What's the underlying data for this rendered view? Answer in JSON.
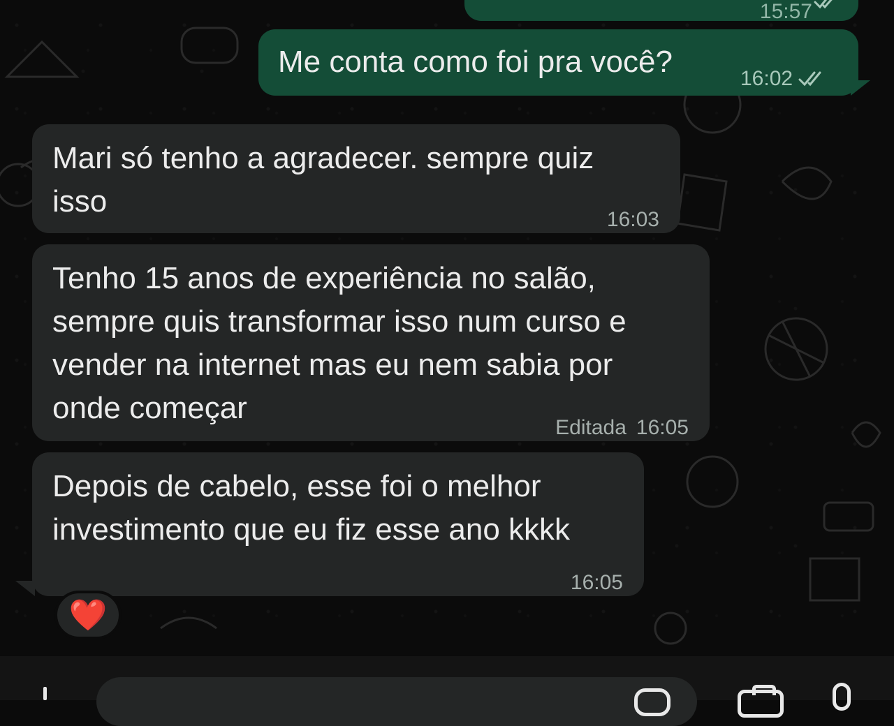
{
  "chat": {
    "messages": [
      {
        "direction": "out",
        "text": "",
        "time": "15:57",
        "status": "read"
      },
      {
        "direction": "out",
        "text": "Me conta como foi pra você?",
        "time": "16:02",
        "status": "read"
      },
      {
        "direction": "in",
        "text": "Mari só tenho a agradecer. sempre quiz\nisso",
        "time": "16:03"
      },
      {
        "direction": "in",
        "text": "Tenho 15 anos de experiência no salão,\nsempre quis transformar isso num curso e\nvender na internet mas eu nem sabia por\nonde começar",
        "edited_label": "Editada",
        "time": "16:05"
      },
      {
        "direction": "in",
        "text": "Depois de cabelo, esse foi o melhor\ninvestimento que eu fiz esse ano kkkk",
        "time": "16:05",
        "reaction": "❤️"
      }
    ]
  },
  "colors": {
    "background": "#0b0b0b",
    "outgoing_bubble": "#144d37",
    "incoming_bubble": "#242626",
    "text": "#ececec",
    "read_ticks": "#a9c9bb",
    "reaction_heart": "#e5262c"
  },
  "icons": {
    "read_receipt": "double-check-icon",
    "attach": "plus-icon",
    "sticker": "sticker-icon",
    "camera": "camera-icon",
    "microphone": "mic-icon"
  }
}
